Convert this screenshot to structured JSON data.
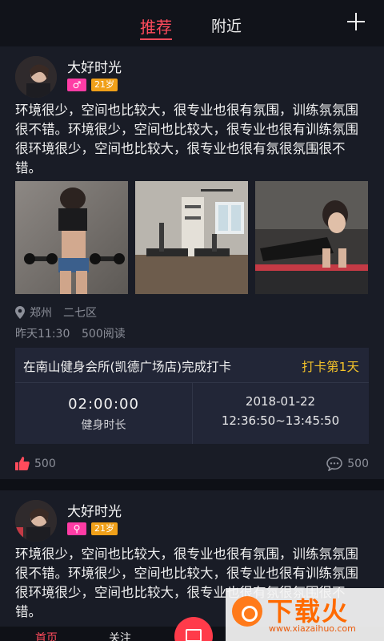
{
  "header": {
    "tabs": [
      {
        "label": "推荐",
        "active": true
      },
      {
        "label": "附近",
        "active": false
      }
    ]
  },
  "posts": [
    {
      "username": "大好时光",
      "gender_icon": "♂",
      "age": "21岁",
      "text": "环境很少，空间也比较大，很专业也很有氛围，训练氛氛围很不错。环境很少，空间也比较大，很专业也很有训练氛围很环境很少，空间也比较大，很专业也很有氛很氛围很不错。",
      "location": "郑州　二七区",
      "time": "昨天11:30",
      "reads": "500阅读",
      "checkin": {
        "place": "在南山健身会所(凯德广场店)完成打卡",
        "day": "打卡第1天",
        "duration": "02:00:00",
        "duration_label": "健身时长",
        "date": "2018-01-22",
        "time_range": "12:36:50~13:45:50"
      },
      "likes": "500",
      "comments": "500"
    },
    {
      "username": "大好时光",
      "gender_icon": "⚲",
      "age": "21岁",
      "text": "环境很少，空间也比较大，很专业也很有氛围，训练氛氛围很不错。环境很少，空间也比较大，很专业也很有训练氛围很环境很少，空间也比较大，很专业也很有氛很氛围很不错。"
    }
  ],
  "bottom_nav": {
    "home": "首页",
    "follow": "关注"
  },
  "watermark": {
    "text": "下载火",
    "url": "www.xiazaihuo.com"
  },
  "colors": {
    "accent": "#ff4b5c",
    "gold": "#f3c22a",
    "background": "#14161d"
  }
}
